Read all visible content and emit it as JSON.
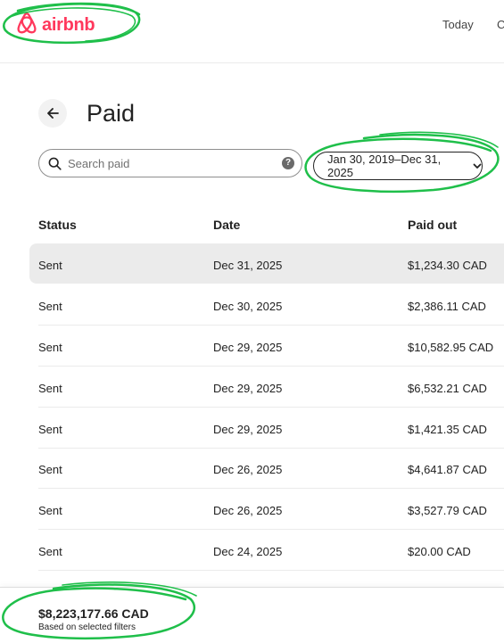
{
  "header": {
    "brand": "airbnb",
    "nav": [
      "Today",
      "C"
    ]
  },
  "page": {
    "title": "Paid"
  },
  "search": {
    "placeholder": "Search paid",
    "value": "",
    "help_icon": "?"
  },
  "date_filter": {
    "label": "Jan 30, 2019–Dec 31, 2025"
  },
  "table": {
    "columns": [
      "Status",
      "Date",
      "Paid out"
    ],
    "rows": [
      {
        "status": "Sent",
        "date": "Dec 31, 2025",
        "amount": "$1,234.30 CAD"
      },
      {
        "status": "Sent",
        "date": "Dec 30, 2025",
        "amount": "$2,386.11 CAD"
      },
      {
        "status": "Sent",
        "date": "Dec 29, 2025",
        "amount": "$10,582.95 CAD"
      },
      {
        "status": "Sent",
        "date": "Dec 29, 2025",
        "amount": "$6,532.21 CAD"
      },
      {
        "status": "Sent",
        "date": "Dec 29, 2025",
        "amount": "$1,421.35 CAD"
      },
      {
        "status": "Sent",
        "date": "Dec 26, 2025",
        "amount": "$4,641.87 CAD"
      },
      {
        "status": "Sent",
        "date": "Dec 26, 2025",
        "amount": "$3,527.79 CAD"
      },
      {
        "status": "Sent",
        "date": "Dec 24, 2025",
        "amount": "$20.00 CAD"
      }
    ]
  },
  "footer": {
    "total": "$8,223,177.66 CAD",
    "caption": "Based on selected filters"
  },
  "colors": {
    "brand": "#ff385c",
    "annotation": "#1fbf4a",
    "row_highlight": "#ebebeb"
  }
}
